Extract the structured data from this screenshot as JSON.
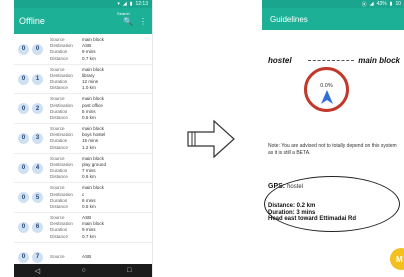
{
  "left": {
    "status": {
      "time": "12:13"
    },
    "appbar": {
      "title": "Offline",
      "hint": "Search",
      "search_glyph": "🔍",
      "menu_glyph": "⋮"
    },
    "rows": [
      {
        "bus": "0",
        "idx": "0",
        "source": "main block",
        "destination": "ASB",
        "duration": "9 mins",
        "distance": "0.7 km"
      },
      {
        "bus": "0",
        "idx": "1",
        "source": "main block",
        "destination": "library",
        "duration": "12 mins",
        "distance": "1.0 km"
      },
      {
        "bus": "0",
        "idx": "2",
        "source": "main block",
        "destination": "post office",
        "duration": "5 mins",
        "distance": "0.5 km"
      },
      {
        "bus": "0",
        "idx": "3",
        "source": "main block",
        "destination": "boys hostel",
        "duration": "15 mins",
        "distance": "1.2 km"
      },
      {
        "bus": "0",
        "idx": "4",
        "source": "main block",
        "destination": "play ground",
        "duration": "7 mins",
        "distance": "0.6 km"
      },
      {
        "bus": "0",
        "idx": "5",
        "source": "main block",
        "destination": "c",
        "duration": "6 mins",
        "distance": "0.5 km"
      },
      {
        "bus": "0",
        "idx": "6",
        "source": "ASB",
        "destination": "main block",
        "duration": "9 mins",
        "distance": "0.7 km"
      },
      {
        "bus": "0",
        "idx": "7",
        "source": "ASB",
        "destination": "",
        "duration": "",
        "distance": ""
      }
    ],
    "labels": {
      "source": "Source",
      "destination": "Destination",
      "duration": "Duration",
      "distance": "Distance"
    },
    "nav": {
      "back": "◁",
      "home": "○",
      "recent": "□"
    }
  },
  "right": {
    "status": {
      "battery": "43%",
      "time": "10"
    },
    "appbar": {
      "title": "Guidelines"
    },
    "from": "hostel",
    "to": "main block",
    "progress": "0.0%",
    "note": "Note: You are advised not to totally depend on this system as it is still a BETA.",
    "gps_label": "GPS:",
    "gps_value": "hostel",
    "distance": "Distance:  0.2 km",
    "duration": "Duration:  3 mins",
    "instruction": "Head east toward Ettimadai Rd",
    "fab_glyph": "M"
  },
  "colors": {
    "primary": "#1cb197",
    "accent": "#f4c020",
    "compass_ring": "#c0392b",
    "arrow": "#2f6fd6"
  }
}
